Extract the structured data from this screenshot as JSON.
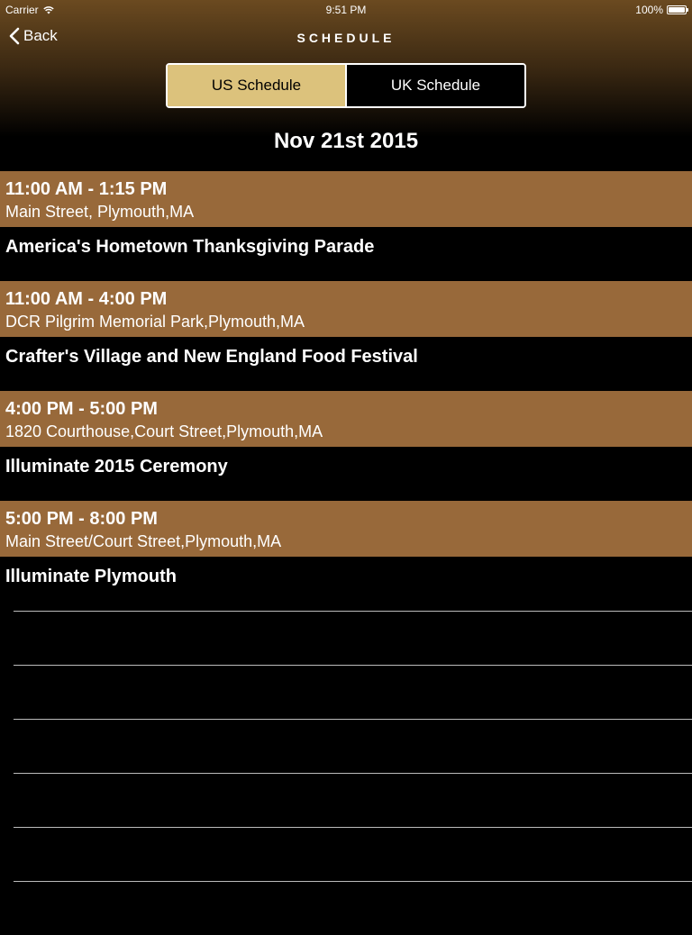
{
  "status_bar": {
    "carrier": "Carrier",
    "time": "9:51 PM",
    "battery": "100%"
  },
  "nav": {
    "back_label": "Back",
    "title": "SCHEDULE"
  },
  "segments": {
    "us_label": "US Schedule",
    "uk_label": "UK Schedule",
    "selected": "US Schedule"
  },
  "date": "Nov 21st 2015",
  "events": [
    {
      "time": "11:00 AM - 1:15 PM",
      "location": "Main Street, Plymouth,MA",
      "title": "America's Hometown Thanksgiving Parade"
    },
    {
      "time": "11:00 AM - 4:00 PM",
      "location": "DCR Pilgrim Memorial Park,Plymouth,MA",
      "title": "Crafter's Village and New England Food Festival"
    },
    {
      "time": "4:00 PM - 5:00 PM",
      "location": "1820 Courthouse,Court Street,Plymouth,MA",
      "title": "Illuminate 2015 Ceremony"
    },
    {
      "time": "5:00 PM - 8:00 PM",
      "location": "Main Street/Court Street,Plymouth,MA",
      "title": "Illuminate Plymouth"
    }
  ],
  "colors": {
    "accent_gold": "#dcc27c",
    "header_brown": "#98693a",
    "background": "#000000"
  },
  "icons": {
    "back": "chevron-left-icon",
    "wifi": "wifi-icon",
    "battery": "battery-icon"
  }
}
